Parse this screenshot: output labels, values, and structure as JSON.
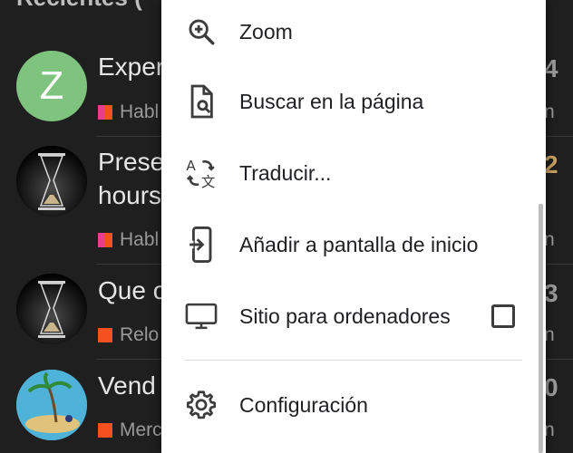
{
  "background": {
    "header": "Recientes (",
    "rows": [
      {
        "avatar_letter": "Z",
        "title": "Exper",
        "subtitle": "Habl",
        "count": "4",
        "count_side": "n",
        "cat_color": "#e83e8c"
      },
      {
        "title_line1": "Prese",
        "title_line2": "hours",
        "subtitle": "Habl",
        "count": "2",
        "count_side": "n",
        "cat_color": "#e83e8c"
      },
      {
        "title": "Que c",
        "subtitle": "Relo",
        "count": "3",
        "count_side": "n",
        "cat_color": "#f4511e"
      },
      {
        "title": "Vend",
        "subtitle": "Merc",
        "count": "0",
        "count_side": "n",
        "cat_color": "#f4511e"
      }
    ]
  },
  "menu": {
    "items": [
      {
        "label": "Zoom",
        "icon": "zoom-in-icon"
      },
      {
        "label": "Buscar en la página",
        "icon": "find-in-page-icon"
      },
      {
        "label": "Traducir...",
        "icon": "translate-icon"
      },
      {
        "label": "Añadir a pantalla de inicio",
        "icon": "add-to-home-screen-icon"
      },
      {
        "label": "Sitio para ordenadores",
        "icon": "desktop-icon",
        "checked": false
      },
      {
        "label": "Configuración",
        "icon": "gear-icon"
      }
    ]
  },
  "colors": {
    "menu_bg": "#ffffff",
    "text": "#202124",
    "icon": "#3c3c3c",
    "backdrop": "#1f1f1f"
  }
}
